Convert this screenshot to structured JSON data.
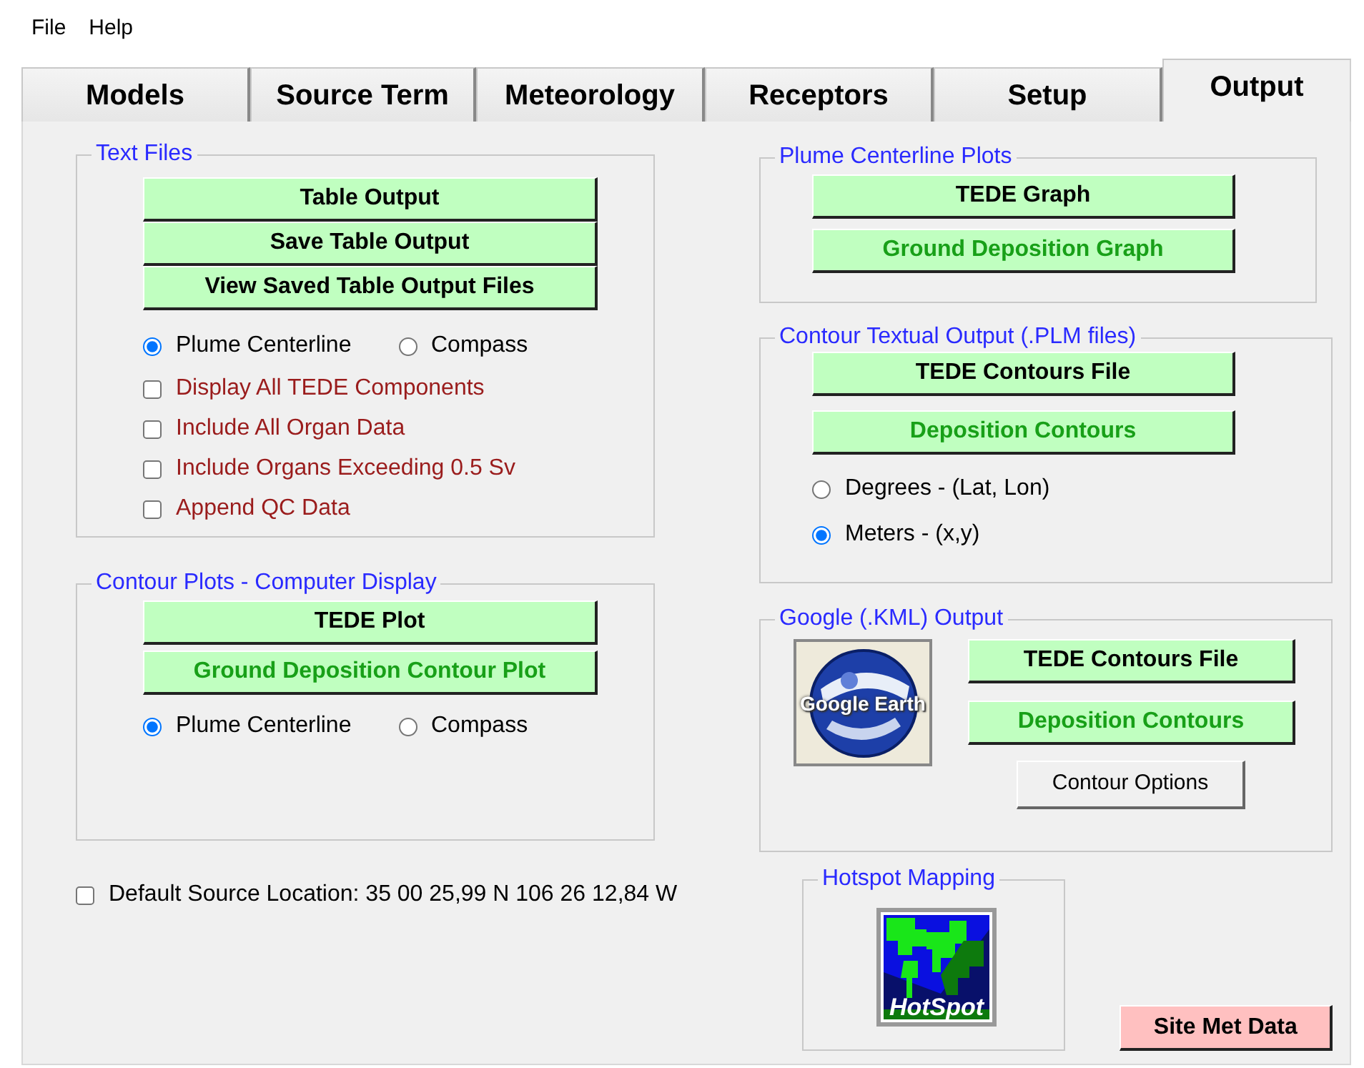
{
  "menu": [
    "File",
    "Help"
  ],
  "tabs": [
    {
      "label": "Models",
      "selected": false
    },
    {
      "label": "Source Term",
      "selected": false
    },
    {
      "label": "Meteorology",
      "selected": false
    },
    {
      "label": "Receptors",
      "selected": false
    },
    {
      "label": "Setup",
      "selected": false
    },
    {
      "label": "Output",
      "selected": true
    }
  ],
  "text_files": {
    "title": "Text Files",
    "buttons": [
      {
        "label": "Table Output",
        "kind": "primary"
      },
      {
        "label": "Save Table Output",
        "kind": "primary"
      },
      {
        "label": "View Saved Table Output Files",
        "kind": "primary"
      }
    ],
    "orientation": [
      {
        "label": "Plume Centerline",
        "selected": true
      },
      {
        "label": "Compass",
        "selected": false
      }
    ],
    "options": [
      {
        "label": "Display All TEDE Components",
        "checked": false
      },
      {
        "label": "Include All Organ Data",
        "checked": false
      },
      {
        "label": "Include Organs Exceeding 0.5 Sv",
        "checked": false
      },
      {
        "label": "Append QC Data",
        "checked": false
      }
    ]
  },
  "contour_plots": {
    "title": "Contour Plots - Computer Display",
    "buttons": [
      {
        "label": "TEDE Plot",
        "kind": "primary"
      },
      {
        "label": "Ground Deposition Contour Plot",
        "kind": "secondary"
      }
    ],
    "orientation": [
      {
        "label": "Plume Centerline",
        "selected": true
      },
      {
        "label": "Compass",
        "selected": false
      }
    ]
  },
  "default_source": {
    "label": "Default Source Location: 35 00 25,99 N 106 26 12,84 W",
    "checked": false
  },
  "plume_plots": {
    "title": "Plume Centerline Plots",
    "buttons": [
      {
        "label": "TEDE Graph",
        "kind": "primary"
      },
      {
        "label": "Ground Deposition Graph",
        "kind": "secondary"
      }
    ]
  },
  "contour_textual": {
    "title": "Contour Textual Output (.PLM files)",
    "buttons": [
      {
        "label": "TEDE Contours File",
        "kind": "primary"
      },
      {
        "label": "Deposition Contours",
        "kind": "secondary"
      }
    ],
    "units": [
      {
        "label": "Degrees - (Lat, Lon)",
        "selected": false
      },
      {
        "label": "Meters - (x,y)",
        "selected": true
      }
    ]
  },
  "google": {
    "title": "Google (.KML) Output",
    "logo_label": "Google Earth",
    "buttons": [
      {
        "label": "TEDE Contours File",
        "kind": "primary"
      },
      {
        "label": "Deposition Contours",
        "kind": "secondary"
      },
      {
        "label": "Contour Options",
        "kind": "standard"
      }
    ]
  },
  "hotspot": {
    "title": "Hotspot Mapping",
    "logo_label": "HotSpot"
  },
  "site_met": {
    "label": "Site Met Data",
    "kind": "alert"
  }
}
